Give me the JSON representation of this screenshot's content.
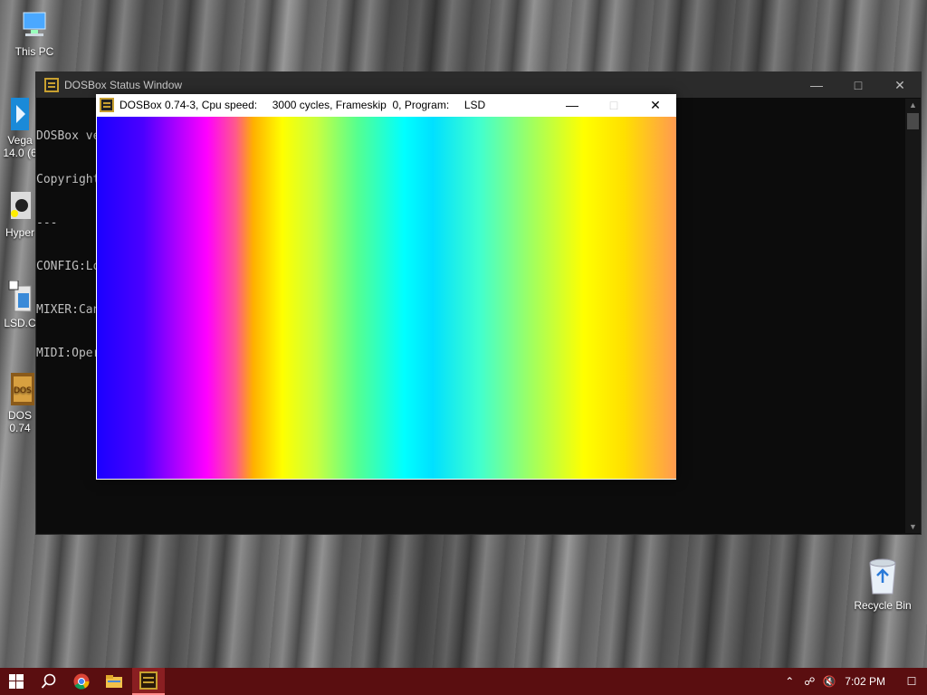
{
  "desktop": {
    "icons": [
      {
        "label": "This PC"
      },
      {
        "label": "Vega\n14.0 (6"
      },
      {
        "label": "Hyper"
      },
      {
        "label": "LSD.C"
      },
      {
        "label": "DOS\n0.74"
      }
    ],
    "recycle_bin": "Recycle Bin"
  },
  "status_window": {
    "title": "DOSBox Status Window",
    "console_lines": [
      "DOSBox ve",
      "Copyright",
      "---",
      "CONFIG:Lo                                                          x-0.74-3.conf",
      "MIXER:Can                                                          de.",
      "MIDI:Oper"
    ]
  },
  "dosbox_window": {
    "title": "DOSBox 0.74-3, Cpu speed:     3000 cycles, Frameskip  0, Program:     LSD",
    "icon_text": "DOS BOX"
  },
  "taskbar": {
    "clock": "7:02 PM",
    "accent": "#5a0e10"
  }
}
